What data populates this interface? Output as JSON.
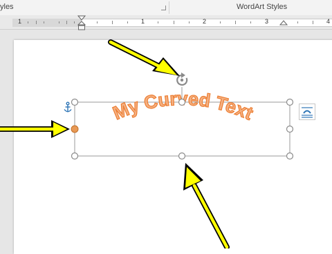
{
  "ribbon": {
    "left_group_label": "yles",
    "wordart_styles_label": "WordArt Styles"
  },
  "ruler": {
    "numbers": [
      "1",
      "1",
      "2",
      "3",
      "4"
    ]
  },
  "text_box": {
    "text": "My Curved Text",
    "text_fill_color": "#f4b183",
    "text_outline_color": "#ed7d31"
  },
  "annotations": {
    "arrow_color": "#ffff00"
  },
  "icons": {
    "anchor": "anchor-icon",
    "rotate": "rotate-handle-icon",
    "layout_options": "layout-options-icon"
  }
}
